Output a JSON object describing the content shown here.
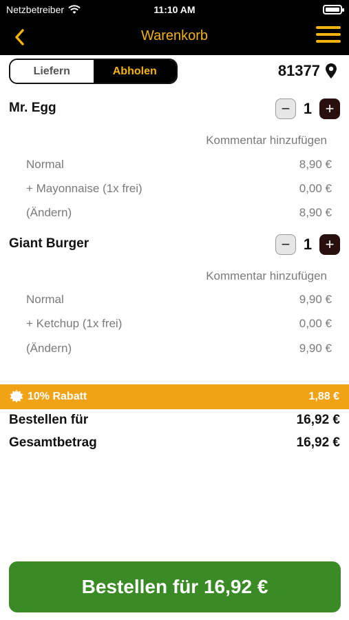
{
  "status_bar": {
    "carrier": "Netzbetreiber",
    "time": "11:10 AM"
  },
  "nav": {
    "title": "Warenkorb"
  },
  "order_type": {
    "deliver": "Liefern",
    "pickup": "Abholen",
    "selected": "Abholen"
  },
  "location": {
    "zip": "81377"
  },
  "items": [
    {
      "name": "Mr. Egg",
      "quantity": "1",
      "comment": "Kommentar hinzufügen",
      "lines": [
        {
          "label": "Normal",
          "price": "8,90 €"
        },
        {
          "label": "+ Mayonnaise (1x frei)",
          "price": "0,00 €"
        },
        {
          "label": "(Ändern)",
          "price": "8,90 €"
        }
      ]
    },
    {
      "name": "Giant Burger",
      "quantity": "1",
      "comment": "Kommentar hinzufügen",
      "lines": [
        {
          "label": "Normal",
          "price": "9,90 €"
        },
        {
          "label": "+ Ketchup (1x frei)",
          "price": "0,00 €"
        },
        {
          "label": "(Ändern)",
          "price": "9,90 €"
        }
      ]
    }
  ],
  "discount": {
    "label": "10% Rabatt",
    "amount": "1,88 €"
  },
  "totals": {
    "order_for_label": "Bestellen für",
    "order_for_value": "16,92 €",
    "grand_total_label": "Gesamtbetrag",
    "grand_total_value": "16,92 €"
  },
  "order_button": {
    "label": "Bestellen für 16,92 €"
  },
  "colors": {
    "accent": "#f4b30d",
    "discount_bar": "#f2a215",
    "order_button": "#3a8a25",
    "plus_button": "#2a0f0f"
  },
  "icons": [
    "wifi-icon",
    "battery-icon",
    "back-chevron-icon",
    "hamburger-menu-icon",
    "location-pin-icon",
    "minus-icon",
    "plus-icon",
    "discount-badge-icon"
  ]
}
